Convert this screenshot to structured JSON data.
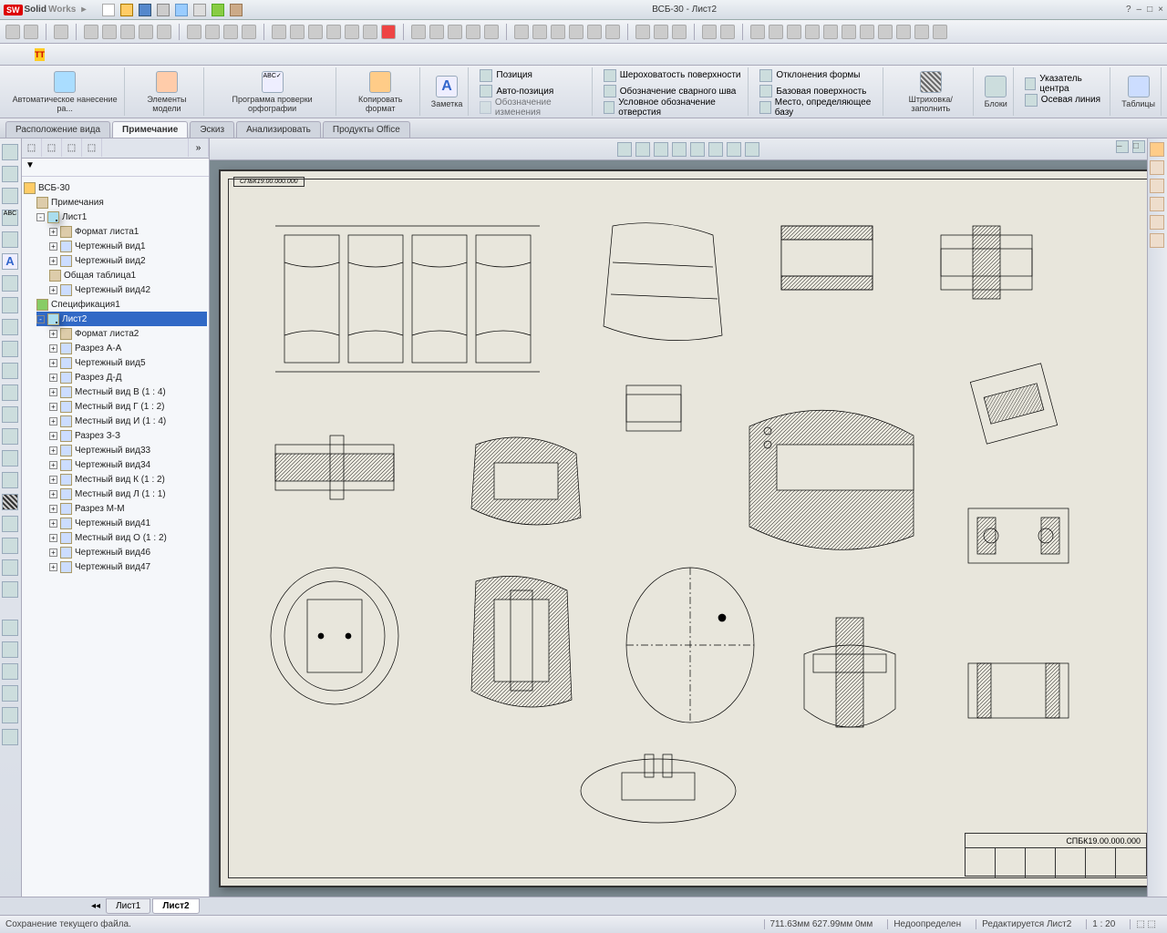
{
  "app": {
    "brand1": "Solid",
    "brand2": "Works"
  },
  "window_title": "ВСБ-30 - Лист2",
  "ribbon": {
    "auto_dim": "Автоматическое\nнанесение ра...",
    "model_items": "Элементы\nмодели",
    "spellcheck": "Программа\nпроверки\nорфографии",
    "copy_format": "Копировать\nформат",
    "note": "Заметка",
    "position": "Позиция",
    "auto_position": "Авто-позиция",
    "rev_symbol": "Обозначение изменения",
    "surface_finish": "Шероховатость поверхности",
    "weld_symbol": "Обозначение сварного шва",
    "hole_callout": "Условное обозначение отверстия",
    "geo_tol": "Отклонения формы",
    "datum": "Базовая поверхность",
    "datum_target": "Место, определяющее базу",
    "hatch": "Штриховка/заполнить",
    "blocks": "Блоки",
    "center_mark": "Указатель центра",
    "centerline": "Осевая линия",
    "tables": "Таблицы"
  },
  "tabs": {
    "view_layout": "Расположение вида",
    "annotation": "Примечание",
    "sketch": "Эскиз",
    "analyze": "Анализировать",
    "office": "Продукты Office"
  },
  "tree": {
    "root": "ВСБ-30",
    "annotations": "Примечания",
    "sheet1": "Лист1",
    "s1_format": "Формат листа1",
    "s1_v1": "Чертежный вид1",
    "s1_v2": "Чертежный вид2",
    "s1_table": "Общая таблица1",
    "s1_v42": "Чертежный вид42",
    "spec": "Спецификация1",
    "sheet2": "Лист2",
    "s2_format": "Формат листа2",
    "sec_aa": "Разрез А-А",
    "s2_v5": "Чертежный вид5",
    "sec_dd": "Разрез Д-Д",
    "det_b": "Местный вид В (1 : 4)",
    "det_g": "Местный вид Г (1 : 2)",
    "det_i": "Местный вид И (1 : 4)",
    "sec_33": "Разрез З-З",
    "s2_v33": "Чертежный вид33",
    "s2_v34": "Чертежный вид34",
    "det_k": "Местный вид К (1 : 2)",
    "det_l": "Местный вид Л (1 : 1)",
    "sec_mm": "Разрез М-М",
    "s2_v41": "Чертежный вид41",
    "det_o": "Местный вид О (1 : 2)",
    "s2_v46": "Чертежный вид46",
    "s2_v47": "Чертежный вид47"
  },
  "drawing": {
    "label_top": "СПБК19.00.000.000",
    "number": "СПБК19.00.000.000"
  },
  "doctabs": {
    "sheet1": "Лист1",
    "sheet2": "Лист2"
  },
  "status": {
    "message": "Сохранение текущего файла.",
    "coords": "711.63мм    627.99мм  0мм",
    "state": "Недоопределен",
    "mode": "Редактируется Лист2",
    "scale": "1 : 20"
  }
}
